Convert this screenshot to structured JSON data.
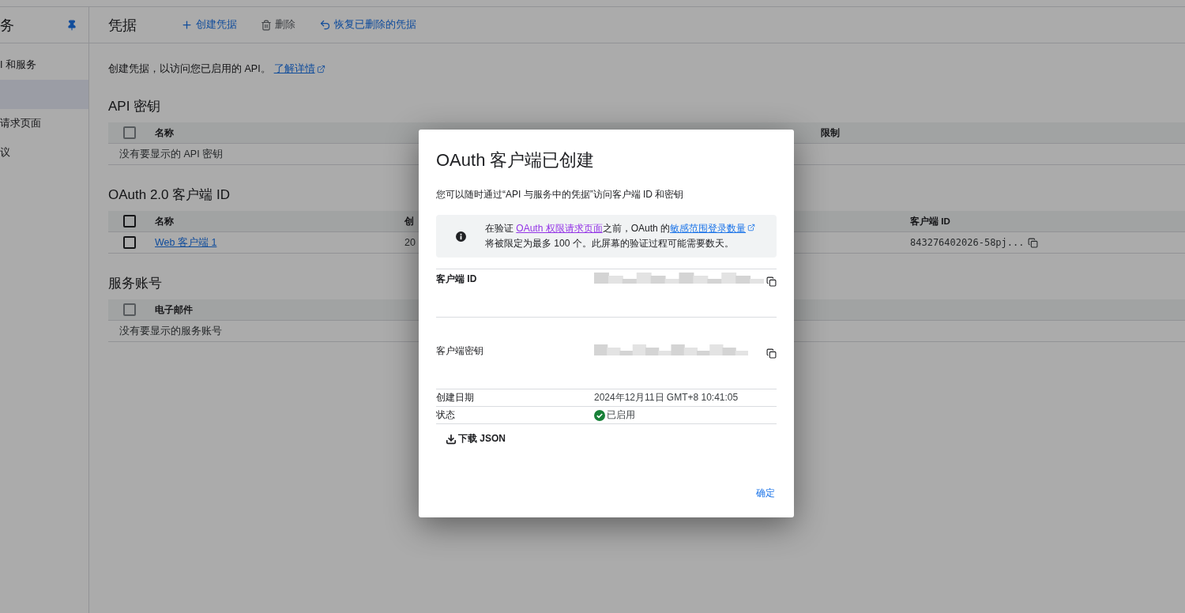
{
  "sidebar": {
    "title": "务",
    "items": [
      {
        "label": "I 和服务",
        "selected": false
      },
      {
        "selected": true
      },
      {
        "label": "请求页面",
        "selected": false
      },
      {
        "label": "议",
        "selected": false
      }
    ]
  },
  "header": {
    "title": "凭据",
    "actions": [
      {
        "kind": "create",
        "label": "创建凭据",
        "disabled": false
      },
      {
        "kind": "delete",
        "label": "删除",
        "disabled": true
      },
      {
        "kind": "restore",
        "label": "恢复已删除的凭据",
        "disabled": false
      }
    ]
  },
  "intro": {
    "text": "创建凭据，以访问您已启用的 API。",
    "link": "了解详情"
  },
  "sections": [
    {
      "kind": "api_keys",
      "title": "API 密钥",
      "select_all": {
        "checked": false,
        "disabled": true
      },
      "columns": [
        "名称",
        "限制"
      ],
      "empty": "没有要显示的 API 密钥"
    },
    {
      "kind": "oauth",
      "title": "OAuth 2.0 客户端 ID",
      "select_all": {
        "checked": false,
        "disabled": false
      },
      "columns": [
        "名称",
        "创",
        "客户端 ID"
      ],
      "rows": [
        {
          "checked": false,
          "name": "Web 客户端 1",
          "created": "20",
          "client_id": "843276402026-58pj..."
        }
      ]
    },
    {
      "kind": "service",
      "title": "服务账号",
      "select_all": {
        "checked": false,
        "disabled": true
      },
      "columns": [
        "电子邮件"
      ],
      "empty": "没有要显示的服务账号"
    }
  ],
  "dialog": {
    "title": "OAuth 客户端已创建",
    "subtitle": "您可以随时通过“API 与服务中的凭据”访问客户端 ID 和密钥",
    "notice": [
      {
        "kind": "text",
        "text": "在验证 "
      },
      {
        "kind": "link",
        "text": "OAuth 权限请求页面",
        "visited": true,
        "external": false
      },
      {
        "kind": "text",
        "text": "之前，OAuth 的"
      },
      {
        "kind": "link",
        "text": "敏感范围登录数量",
        "visited": false,
        "external": true
      },
      {
        "kind": "text",
        "text": "将被限定为最多 100 个。此屏幕的验证过程可能需要数天。"
      }
    ],
    "details": [
      {
        "kind": "hidden",
        "label": "客户端 ID",
        "bold": true
      },
      {
        "kind": "hidden",
        "label": "客户端密钥",
        "bold": false
      },
      {
        "kind": "text",
        "label": "创建日期",
        "value": "2024年12月11日 GMT+8 10:41:05"
      },
      {
        "kind": "status",
        "label": "状态",
        "value": "已启用"
      }
    ],
    "download": "下载 JSON",
    "ok": "确定"
  }
}
